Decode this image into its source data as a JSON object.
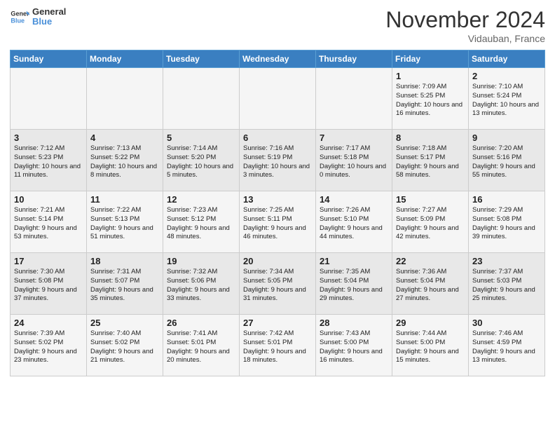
{
  "header": {
    "logo_line1": "General",
    "logo_line2": "Blue",
    "month": "November 2024",
    "location": "Vidauban, France"
  },
  "days_of_week": [
    "Sunday",
    "Monday",
    "Tuesday",
    "Wednesday",
    "Thursday",
    "Friday",
    "Saturday"
  ],
  "weeks": [
    [
      {
        "day": "",
        "info": ""
      },
      {
        "day": "",
        "info": ""
      },
      {
        "day": "",
        "info": ""
      },
      {
        "day": "",
        "info": ""
      },
      {
        "day": "",
        "info": ""
      },
      {
        "day": "1",
        "info": "Sunrise: 7:09 AM\nSunset: 5:25 PM\nDaylight: 10 hours and 16 minutes."
      },
      {
        "day": "2",
        "info": "Sunrise: 7:10 AM\nSunset: 5:24 PM\nDaylight: 10 hours and 13 minutes."
      }
    ],
    [
      {
        "day": "3",
        "info": "Sunrise: 7:12 AM\nSunset: 5:23 PM\nDaylight: 10 hours and 11 minutes."
      },
      {
        "day": "4",
        "info": "Sunrise: 7:13 AM\nSunset: 5:22 PM\nDaylight: 10 hours and 8 minutes."
      },
      {
        "day": "5",
        "info": "Sunrise: 7:14 AM\nSunset: 5:20 PM\nDaylight: 10 hours and 5 minutes."
      },
      {
        "day": "6",
        "info": "Sunrise: 7:16 AM\nSunset: 5:19 PM\nDaylight: 10 hours and 3 minutes."
      },
      {
        "day": "7",
        "info": "Sunrise: 7:17 AM\nSunset: 5:18 PM\nDaylight: 10 hours and 0 minutes."
      },
      {
        "day": "8",
        "info": "Sunrise: 7:18 AM\nSunset: 5:17 PM\nDaylight: 9 hours and 58 minutes."
      },
      {
        "day": "9",
        "info": "Sunrise: 7:20 AM\nSunset: 5:16 PM\nDaylight: 9 hours and 55 minutes."
      }
    ],
    [
      {
        "day": "10",
        "info": "Sunrise: 7:21 AM\nSunset: 5:14 PM\nDaylight: 9 hours and 53 minutes."
      },
      {
        "day": "11",
        "info": "Sunrise: 7:22 AM\nSunset: 5:13 PM\nDaylight: 9 hours and 51 minutes."
      },
      {
        "day": "12",
        "info": "Sunrise: 7:23 AM\nSunset: 5:12 PM\nDaylight: 9 hours and 48 minutes."
      },
      {
        "day": "13",
        "info": "Sunrise: 7:25 AM\nSunset: 5:11 PM\nDaylight: 9 hours and 46 minutes."
      },
      {
        "day": "14",
        "info": "Sunrise: 7:26 AM\nSunset: 5:10 PM\nDaylight: 9 hours and 44 minutes."
      },
      {
        "day": "15",
        "info": "Sunrise: 7:27 AM\nSunset: 5:09 PM\nDaylight: 9 hours and 42 minutes."
      },
      {
        "day": "16",
        "info": "Sunrise: 7:29 AM\nSunset: 5:08 PM\nDaylight: 9 hours and 39 minutes."
      }
    ],
    [
      {
        "day": "17",
        "info": "Sunrise: 7:30 AM\nSunset: 5:08 PM\nDaylight: 9 hours and 37 minutes."
      },
      {
        "day": "18",
        "info": "Sunrise: 7:31 AM\nSunset: 5:07 PM\nDaylight: 9 hours and 35 minutes."
      },
      {
        "day": "19",
        "info": "Sunrise: 7:32 AM\nSunset: 5:06 PM\nDaylight: 9 hours and 33 minutes."
      },
      {
        "day": "20",
        "info": "Sunrise: 7:34 AM\nSunset: 5:05 PM\nDaylight: 9 hours and 31 minutes."
      },
      {
        "day": "21",
        "info": "Sunrise: 7:35 AM\nSunset: 5:04 PM\nDaylight: 9 hours and 29 minutes."
      },
      {
        "day": "22",
        "info": "Sunrise: 7:36 AM\nSunset: 5:04 PM\nDaylight: 9 hours and 27 minutes."
      },
      {
        "day": "23",
        "info": "Sunrise: 7:37 AM\nSunset: 5:03 PM\nDaylight: 9 hours and 25 minutes."
      }
    ],
    [
      {
        "day": "24",
        "info": "Sunrise: 7:39 AM\nSunset: 5:02 PM\nDaylight: 9 hours and 23 minutes."
      },
      {
        "day": "25",
        "info": "Sunrise: 7:40 AM\nSunset: 5:02 PM\nDaylight: 9 hours and 21 minutes."
      },
      {
        "day": "26",
        "info": "Sunrise: 7:41 AM\nSunset: 5:01 PM\nDaylight: 9 hours and 20 minutes."
      },
      {
        "day": "27",
        "info": "Sunrise: 7:42 AM\nSunset: 5:01 PM\nDaylight: 9 hours and 18 minutes."
      },
      {
        "day": "28",
        "info": "Sunrise: 7:43 AM\nSunset: 5:00 PM\nDaylight: 9 hours and 16 minutes."
      },
      {
        "day": "29",
        "info": "Sunrise: 7:44 AM\nSunset: 5:00 PM\nDaylight: 9 hours and 15 minutes."
      },
      {
        "day": "30",
        "info": "Sunrise: 7:46 AM\nSunset: 4:59 PM\nDaylight: 9 hours and 13 minutes."
      }
    ]
  ]
}
